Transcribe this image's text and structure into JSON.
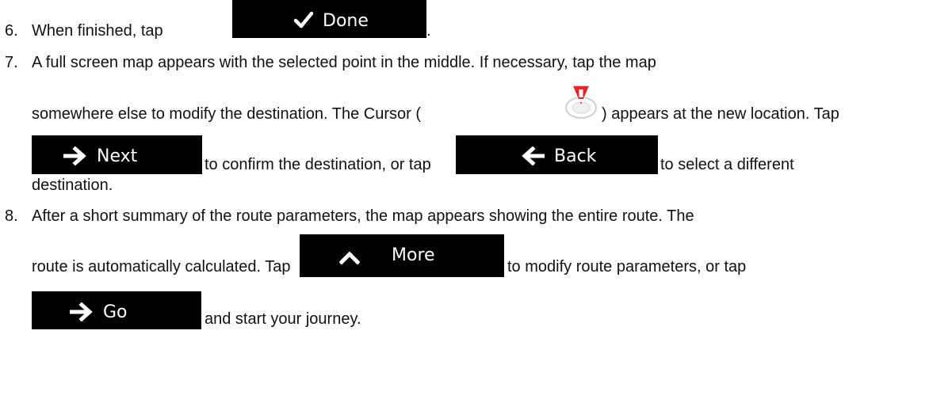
{
  "steps": [
    {
      "number": "6.",
      "text_before": "When finished, tap",
      "text_after": "."
    },
    {
      "number": "7.",
      "line1": "A full screen map appears with the selected point in the middle. If necessary, tap the map",
      "line2_a": "somewhere else to modify the destination. The Cursor (",
      "line2_b": ") appears at the new location. Tap",
      "line3_a": "to confirm the destination, or tap",
      "line3_b": "to select a different",
      "line4": "destination."
    },
    {
      "number": "8.",
      "line1": "After a short summary of the route parameters, the map appears showing the entire route. The",
      "line2_a": "route is automatically calculated. Tap",
      "line2_b": "to modify route parameters, or tap",
      "line3": "and start your journey."
    }
  ],
  "buttons": {
    "done": {
      "label": "Done",
      "icon": "check-icon"
    },
    "next": {
      "label": "Next",
      "icon": "arrow-right-icon"
    },
    "back": {
      "label": "Back",
      "icon": "arrow-left-icon"
    },
    "more": {
      "label": "More",
      "icon": "chevron-up-icon"
    },
    "go": {
      "label": "Go",
      "icon": "arrow-right-icon"
    }
  },
  "colors": {
    "button_bg": "#000000",
    "button_text": "#ffffff",
    "cursor_red": "#e8242b"
  }
}
